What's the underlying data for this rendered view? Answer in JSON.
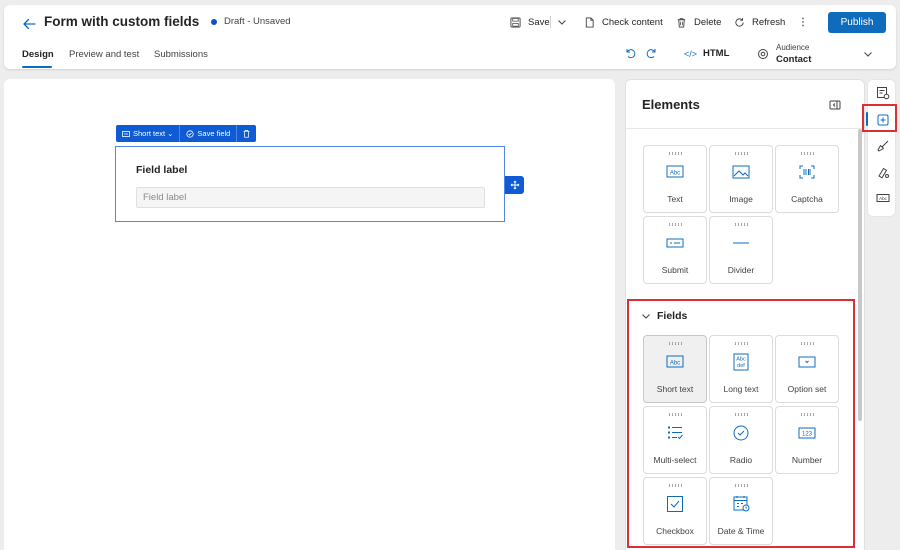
{
  "header": {
    "title": "Form with custom fields",
    "status": "Draft - Unsaved",
    "status_color": "#0f4fce",
    "actions": {
      "save": "Save",
      "check_content": "Check content",
      "delete": "Delete",
      "refresh": "Refresh",
      "publish": "Publish"
    },
    "tabs": [
      {
        "label": "Design",
        "active": true
      },
      {
        "label": "Preview and test",
        "active": false
      },
      {
        "label": "Submissions",
        "active": false
      }
    ],
    "html_label": "HTML",
    "audience": {
      "label": "Audience",
      "value": "Contact"
    }
  },
  "canvas": {
    "toolbar": {
      "field_type": "Short text",
      "save_field": "Save field"
    },
    "field": {
      "label": "Field label",
      "placeholder": "Field label"
    }
  },
  "elements_panel": {
    "title": "Elements",
    "basic_elements": [
      {
        "label": "Text",
        "icon": "abc-text-icon"
      },
      {
        "label": "Image",
        "icon": "image-icon"
      },
      {
        "label": "Captcha",
        "icon": "captcha-icon"
      },
      {
        "label": "Submit",
        "icon": "submit-icon"
      },
      {
        "label": "Divider",
        "icon": "divider-icon"
      }
    ],
    "fields_section": {
      "title": "Fields",
      "items": [
        {
          "label": "Short text",
          "icon": "short-text-icon",
          "selected": true
        },
        {
          "label": "Long text",
          "icon": "long-text-icon",
          "selected": false
        },
        {
          "label": "Option set",
          "icon": "option-set-icon",
          "selected": false
        },
        {
          "label": "Multi-select",
          "icon": "multi-select-icon",
          "selected": false
        },
        {
          "label": "Radio",
          "icon": "radio-icon",
          "selected": false
        },
        {
          "label": "Number",
          "icon": "number-icon",
          "selected": false
        },
        {
          "label": "Checkbox",
          "icon": "checkbox-icon",
          "selected": false
        },
        {
          "label": "Date & Time",
          "icon": "calendar-icon",
          "selected": false
        }
      ]
    }
  },
  "right_rail": {
    "buttons": [
      "form-settings-icon",
      "add-element-icon",
      "theme-brush-icon",
      "personalization-icon",
      "text-style-icon"
    ],
    "active": "add-element-icon"
  },
  "colors": {
    "accent": "#0f6cbd",
    "field_toolbar": "#0f5bd4",
    "highlight": "#d93036"
  }
}
